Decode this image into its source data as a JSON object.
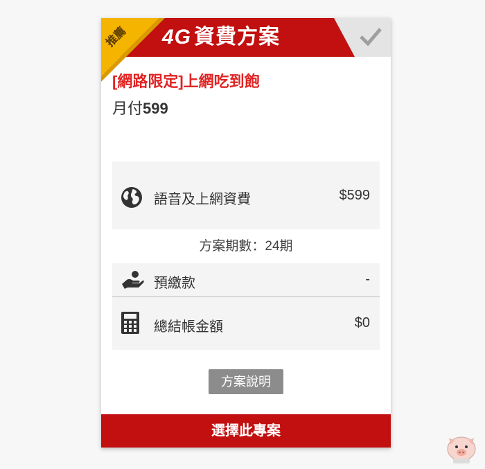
{
  "header": {
    "title_4g": "4G",
    "title_rest": "資費方案",
    "ribbon": "推薦",
    "accent_color": "#c20f0f",
    "ribbon_color": "#f5b400"
  },
  "plan": {
    "name": "[網路限定]上網吃到飽",
    "price_prefix": "月付",
    "price_value": "599"
  },
  "rows": {
    "voice": {
      "label": "語音及上網資費",
      "value": "$599",
      "icon": "globe-icon"
    },
    "term": "方案期數：24期",
    "prepay": {
      "label": "預繳款",
      "value": "-",
      "icon": "hand-payment-icon"
    },
    "total": {
      "label": "總結帳金額",
      "value": "$0",
      "icon": "calculator-icon"
    }
  },
  "buttons": {
    "description": "方案說明",
    "select": "選擇此專案"
  }
}
